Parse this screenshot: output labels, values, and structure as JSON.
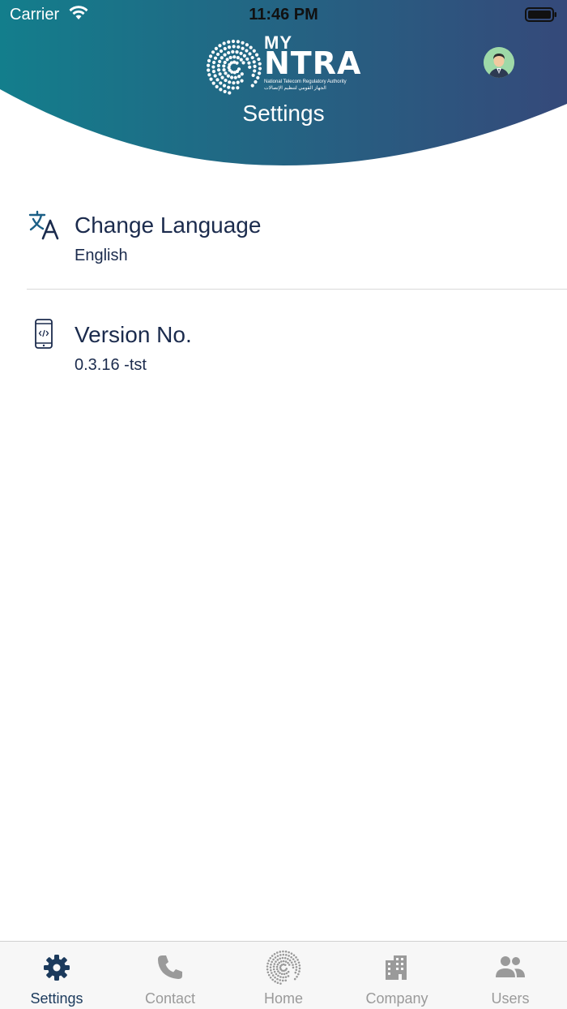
{
  "status_bar": {
    "carrier": "Carrier",
    "time": "11:46 PM"
  },
  "header": {
    "logo": {
      "line1": "MY",
      "line2": "NTRA",
      "tagline_en": "National Telecom Regulatory Authority",
      "tagline_ar": "الجهاز القومي لتنظيم الإتصالات"
    },
    "title": "Settings",
    "gradient_start": "#137e8c",
    "gradient_end": "#35497a"
  },
  "settings": {
    "items": [
      {
        "title": "Change Language",
        "value": "English",
        "icon": "translate-icon"
      },
      {
        "title": "Version No.",
        "value": "0.3.16 -tst",
        "icon": "phone-code-icon"
      }
    ]
  },
  "tab_bar": {
    "active_color": "#1b3a5c",
    "inactive_color": "#9a9a9a",
    "tabs": [
      {
        "label": "Settings",
        "icon": "gear-icon",
        "active": true
      },
      {
        "label": "Contact",
        "icon": "phone-icon",
        "active": false
      },
      {
        "label": "Home",
        "icon": "ntra-logo-icon",
        "active": false
      },
      {
        "label": "Company",
        "icon": "building-icon",
        "active": false
      },
      {
        "label": "Users",
        "icon": "users-icon",
        "active": false
      }
    ]
  }
}
